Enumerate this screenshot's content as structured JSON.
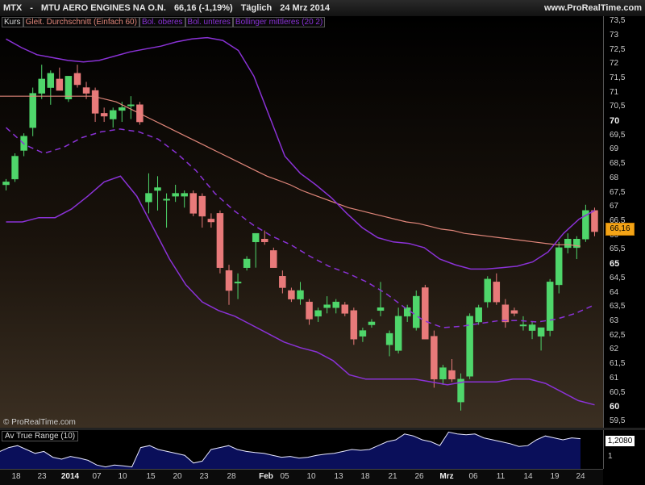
{
  "header": {
    "symbol": "MTX",
    "sep": "-",
    "name": "MTU AERO ENGINES NA O.N.",
    "last": "66,16 (-1,19%)",
    "period": "Täglich",
    "date": "24 Mrz 2014",
    "site": "www.ProRealTime.com"
  },
  "legend": {
    "kurs": "Kurs",
    "ma": "Gleit. Durchschnitt (Einfach 60)",
    "bb_upper": "Bol. oberes",
    "bb_lower": "Bol. unteres",
    "bb_mid": "Bollinger mittleres (20 2)"
  },
  "copyright": "© ProRealTime.com",
  "atr": {
    "label": "Av True Range (10)",
    "value": "1,2080",
    "tick": "1"
  },
  "price_badge": "66,16",
  "colors": {
    "up": "#4fd66b",
    "down": "#e87a7a",
    "ma": "#e0867a",
    "bollinger": "#8a32d6",
    "atr_fill": "#0a0f5a",
    "badge": "#f4a417"
  },
  "chart_data": [
    {
      "type": "candlestick",
      "title": "MTX - MTU AERO ENGINES NA O.N.",
      "ylim": [
        59.3,
        73.7
      ],
      "y_ticks": [
        "73,5",
        "73",
        "72,5",
        "72",
        "71,5",
        "71",
        "70,5",
        "70",
        "69,5",
        "69",
        "68,5",
        "68",
        "67,5",
        "67",
        "66,5",
        "66",
        "65,5",
        "65",
        "64,5",
        "64",
        "63,5",
        "63",
        "62,5",
        "62",
        "61,5",
        "61",
        "60,5",
        "60",
        "59,5"
      ],
      "x_ticks": [
        "18",
        "23",
        "2014",
        "07",
        "10",
        "15",
        "20",
        "23",
        "28",
        "Feb",
        "05",
        "10",
        "13",
        "18",
        "21",
        "26",
        "Mrz",
        "06",
        "11",
        "14",
        "19",
        "24"
      ],
      "candles": [
        {
          "o": 67.8,
          "h": 68.0,
          "l": 67.6,
          "c": 67.9
        },
        {
          "o": 68.0,
          "h": 68.9,
          "l": 67.9,
          "c": 68.8
        },
        {
          "o": 69.0,
          "h": 69.6,
          "l": 68.8,
          "c": 69.5
        },
        {
          "o": 69.8,
          "h": 71.2,
          "l": 69.5,
          "c": 71.0
        },
        {
          "o": 71.0,
          "h": 72.0,
          "l": 70.8,
          "c": 71.5
        },
        {
          "o": 71.2,
          "h": 71.8,
          "l": 70.6,
          "c": 71.7
        },
        {
          "o": 71.5,
          "h": 71.9,
          "l": 71.1,
          "c": 71.1
        },
        {
          "o": 70.8,
          "h": 71.6,
          "l": 70.7,
          "c": 71.6
        },
        {
          "o": 71.7,
          "h": 72.0,
          "l": 71.2,
          "c": 71.3
        },
        {
          "o": 71.2,
          "h": 71.4,
          "l": 70.8,
          "c": 71.0
        },
        {
          "o": 71.1,
          "h": 71.2,
          "l": 70.0,
          "c": 70.3
        },
        {
          "o": 70.3,
          "h": 70.5,
          "l": 70.0,
          "c": 70.2
        },
        {
          "o": 70.1,
          "h": 70.5,
          "l": 69.8,
          "c": 70.4
        },
        {
          "o": 70.4,
          "h": 70.7,
          "l": 70.0,
          "c": 70.5
        },
        {
          "o": 70.6,
          "h": 70.9,
          "l": 70.1,
          "c": 70.6
        },
        {
          "o": 70.6,
          "h": 70.7,
          "l": 69.9,
          "c": 70.0
        },
        {
          "o": 67.2,
          "h": 68.2,
          "l": 66.8,
          "c": 67.5
        },
        {
          "o": 67.6,
          "h": 68.1,
          "l": 66.9,
          "c": 67.7
        },
        {
          "o": 67.3,
          "h": 67.5,
          "l": 66.3,
          "c": 67.3
        },
        {
          "o": 67.4,
          "h": 67.8,
          "l": 67.2,
          "c": 67.5
        },
        {
          "o": 67.4,
          "h": 67.6,
          "l": 67.0,
          "c": 67.5
        },
        {
          "o": 67.5,
          "h": 67.6,
          "l": 66.7,
          "c": 66.8
        },
        {
          "o": 67.4,
          "h": 67.5,
          "l": 66.3,
          "c": 66.7
        },
        {
          "o": 66.6,
          "h": 66.8,
          "l": 66.3,
          "c": 66.5
        },
        {
          "o": 66.8,
          "h": 66.9,
          "l": 64.7,
          "c": 64.9
        },
        {
          "o": 64.8,
          "h": 65.0,
          "l": 63.6,
          "c": 64.1
        },
        {
          "o": 64.4,
          "h": 64.7,
          "l": 63.8,
          "c": 64.4
        },
        {
          "o": 64.9,
          "h": 65.3,
          "l": 64.8,
          "c": 65.2
        },
        {
          "o": 65.8,
          "h": 66.0,
          "l": 64.9,
          "c": 66.1
        },
        {
          "o": 65.9,
          "h": 66.2,
          "l": 65.7,
          "c": 65.8
        },
        {
          "o": 65.5,
          "h": 65.6,
          "l": 64.9,
          "c": 64.9
        },
        {
          "o": 64.6,
          "h": 64.8,
          "l": 64.0,
          "c": 64.2
        },
        {
          "o": 64.1,
          "h": 64.2,
          "l": 63.7,
          "c": 63.8
        },
        {
          "o": 63.8,
          "h": 64.4,
          "l": 63.6,
          "c": 64.1
        },
        {
          "o": 63.7,
          "h": 63.8,
          "l": 62.9,
          "c": 63.1
        },
        {
          "o": 63.2,
          "h": 63.5,
          "l": 63.0,
          "c": 63.4
        },
        {
          "o": 63.5,
          "h": 63.9,
          "l": 63.3,
          "c": 63.6
        },
        {
          "o": 63.5,
          "h": 63.8,
          "l": 63.3,
          "c": 63.7
        },
        {
          "o": 63.6,
          "h": 63.7,
          "l": 63.2,
          "c": 63.3
        },
        {
          "o": 63.4,
          "h": 63.5,
          "l": 62.2,
          "c": 62.4
        },
        {
          "o": 62.5,
          "h": 62.8,
          "l": 62.3,
          "c": 62.7
        },
        {
          "o": 62.9,
          "h": 63.1,
          "l": 62.8,
          "c": 63.0
        },
        {
          "o": 63.4,
          "h": 64.4,
          "l": 63.2,
          "c": 63.5
        },
        {
          "o": 62.2,
          "h": 62.7,
          "l": 61.8,
          "c": 62.6
        },
        {
          "o": 62.0,
          "h": 63.5,
          "l": 61.9,
          "c": 63.2
        },
        {
          "o": 63.2,
          "h": 63.6,
          "l": 63.0,
          "c": 63.5
        },
        {
          "o": 62.8,
          "h": 64.1,
          "l": 62.7,
          "c": 63.9
        },
        {
          "o": 64.2,
          "h": 64.3,
          "l": 62.4,
          "c": 62.4
        },
        {
          "o": 62.5,
          "h": 62.7,
          "l": 60.7,
          "c": 61.0
        },
        {
          "o": 61.0,
          "h": 61.5,
          "l": 60.8,
          "c": 61.4
        },
        {
          "o": 61.3,
          "h": 61.7,
          "l": 60.9,
          "c": 61.0
        },
        {
          "o": 60.2,
          "h": 61.2,
          "l": 59.9,
          "c": 61.0
        },
        {
          "o": 61.1,
          "h": 63.3,
          "l": 61.0,
          "c": 63.2
        },
        {
          "o": 63.0,
          "h": 63.6,
          "l": 62.9,
          "c": 63.5
        },
        {
          "o": 63.7,
          "h": 64.6,
          "l": 63.5,
          "c": 64.5
        },
        {
          "o": 64.4,
          "h": 64.7,
          "l": 63.6,
          "c": 63.7
        },
        {
          "o": 63.6,
          "h": 63.8,
          "l": 62.8,
          "c": 63.0
        },
        {
          "o": 63.4,
          "h": 63.5,
          "l": 63.2,
          "c": 63.3
        },
        {
          "o": 62.9,
          "h": 63.2,
          "l": 62.7,
          "c": 62.9
        },
        {
          "o": 62.7,
          "h": 63.0,
          "l": 62.4,
          "c": 62.9
        },
        {
          "o": 62.5,
          "h": 62.8,
          "l": 62.0,
          "c": 62.8
        },
        {
          "o": 62.7,
          "h": 64.5,
          "l": 62.5,
          "c": 64.4
        },
        {
          "o": 64.3,
          "h": 65.8,
          "l": 64.0,
          "c": 65.6
        },
        {
          "o": 65.6,
          "h": 66.1,
          "l": 65.4,
          "c": 65.9
        },
        {
          "o": 65.6,
          "h": 66.0,
          "l": 65.2,
          "c": 65.9
        },
        {
          "o": 65.9,
          "h": 67.1,
          "l": 65.8,
          "c": 66.9
        },
        {
          "o": 66.9,
          "h": 67.0,
          "l": 66.0,
          "c": 66.16
        }
      ],
      "sma60": [
        70.9,
        70.9,
        70.9,
        70.9,
        70.9,
        70.9,
        70.9,
        70.9,
        70.9,
        70.8,
        70.7,
        70.5,
        70.3,
        70.1,
        69.9,
        69.7,
        69.5,
        69.3,
        69.1,
        68.9,
        68.7,
        68.5,
        68.3,
        68.1,
        67.95,
        67.8,
        67.6,
        67.45,
        67.3,
        67.15,
        67.0,
        66.9,
        66.8,
        66.7,
        66.6,
        66.5,
        66.45,
        66.35,
        66.25,
        66.2,
        66.1,
        66.05,
        66.0,
        65.95,
        65.9,
        65.85,
        65.8,
        65.75,
        65.7,
        65.7,
        65.65
      ],
      "bb_upper": [
        72.9,
        72.6,
        72.35,
        72.25,
        72.15,
        72.1,
        72.15,
        72.3,
        72.45,
        72.55,
        72.65,
        72.8,
        72.9,
        72.95,
        72.85,
        72.5,
        71.6,
        70.2,
        68.8,
        68.2,
        67.8,
        67.35,
        66.8,
        66.3,
        65.95,
        65.8,
        65.75,
        65.6,
        65.2,
        65.0,
        64.85,
        64.85,
        64.9,
        64.95,
        65.1,
        65.45,
        66.1,
        66.6,
        66.9
      ],
      "bb_middle": [
        69.8,
        69.2,
        68.9,
        69.1,
        69.45,
        69.65,
        69.75,
        69.65,
        69.4,
        68.9,
        68.3,
        67.5,
        66.9,
        66.4,
        66.0,
        65.7,
        65.3,
        64.95,
        64.7,
        64.4,
        64.0,
        63.5,
        63.05,
        62.8,
        62.85,
        62.95,
        63.05,
        63.05,
        63.0,
        63.1,
        63.3,
        63.6
      ],
      "bb_lower": [
        66.5,
        66.5,
        66.65,
        66.65,
        66.95,
        67.4,
        67.9,
        68.1,
        67.4,
        66.3,
        65.2,
        64.3,
        63.7,
        63.4,
        63.2,
        62.9,
        62.6,
        62.3,
        62.1,
        61.95,
        61.65,
        61.15,
        61.0,
        61.0,
        61.0,
        61.0,
        60.9,
        60.8,
        60.9,
        60.9,
        60.9,
        61.0,
        61.0,
        60.85,
        60.55,
        60.25,
        60.1
      ]
    },
    {
      "type": "area",
      "title": "Av True Range (10)",
      "ylim": [
        0.4,
        1.4
      ],
      "values": [
        0.85,
        0.95,
        1.0,
        0.9,
        0.8,
        0.85,
        0.7,
        0.65,
        0.72,
        0.68,
        0.62,
        0.5,
        0.45,
        0.5,
        0.48,
        0.45,
        0.95,
        1.0,
        0.9,
        0.85,
        0.8,
        0.75,
        0.55,
        0.6,
        0.9,
        0.95,
        1.0,
        0.9,
        0.85,
        0.82,
        0.8,
        0.75,
        0.7,
        0.72,
        0.68,
        0.7,
        0.75,
        0.78,
        0.8,
        0.85,
        0.9,
        0.88,
        0.9,
        1.0,
        1.1,
        1.15,
        1.3,
        1.25,
        1.15,
        1.1,
        1.0,
        1.35,
        1.3,
        1.28,
        1.3,
        1.2,
        1.15,
        1.1,
        1.05,
        0.98,
        1.0,
        1.15,
        1.25,
        1.2,
        1.15,
        1.2,
        1.18
      ]
    }
  ]
}
